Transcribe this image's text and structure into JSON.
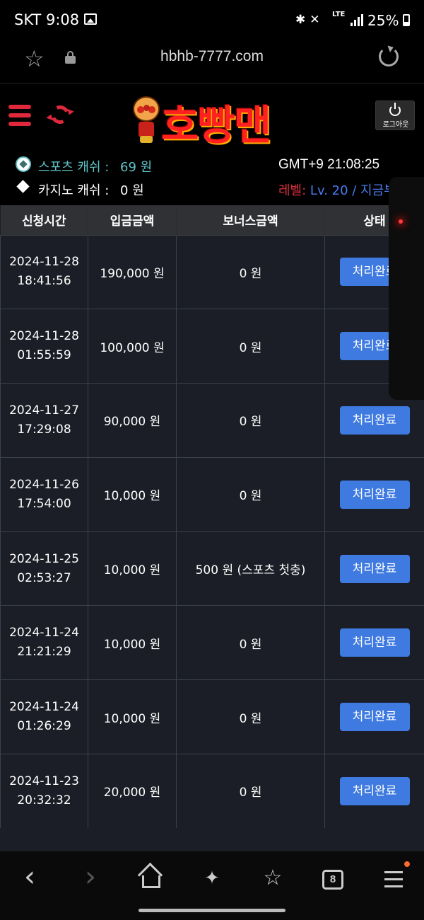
{
  "status_bar": {
    "time": "SKT 9:08",
    "battery": "25%",
    "network": "LTE"
  },
  "browser": {
    "url": "hbhb-7777.com",
    "open_tabs": "8"
  },
  "site": {
    "logo_text": "호빵맨",
    "logout_label": "로그아웃",
    "sports_cash_label": "스포츠 캐쉬 :",
    "sports_cash_value": "69 원",
    "casino_cash_label": "카지노 캐쉬 :",
    "casino_cash_value": "0 원",
    "clock": "GMT+9 21:08:25",
    "level_label": "레벨:",
    "level_value": "Lv. 20 / 지금부"
  },
  "table": {
    "headers": [
      "신청시간",
      "입금금액",
      "보너스금액",
      "상태"
    ],
    "rows": [
      {
        "date": "2024-11-28",
        "time": "18:41:56",
        "amount": "190,000 원",
        "bonus": "0 원",
        "status": "처리완료"
      },
      {
        "date": "2024-11-28",
        "time": "01:55:59",
        "amount": "100,000 원",
        "bonus": "0 원",
        "status": "처리완료"
      },
      {
        "date": "2024-11-27",
        "time": "17:29:08",
        "amount": "90,000 원",
        "bonus": "0 원",
        "status": "처리완료"
      },
      {
        "date": "2024-11-26",
        "time": "17:54:00",
        "amount": "10,000 원",
        "bonus": "0 원",
        "status": "처리완료"
      },
      {
        "date": "2024-11-25",
        "time": "02:53:27",
        "amount": "10,000 원",
        "bonus": "500 원 (스포츠 첫충)",
        "status": "처리완료"
      },
      {
        "date": "2024-11-24",
        "time": "21:21:29",
        "amount": "10,000 원",
        "bonus": "0 원",
        "status": "처리완료"
      },
      {
        "date": "2024-11-24",
        "time": "01:26:29",
        "amount": "10,000 원",
        "bonus": "0 원",
        "status": "처리완료"
      },
      {
        "date": "2024-11-23",
        "time": "20:32:32",
        "amount": "20,000 원",
        "bonus": "0 원",
        "status": "처리완료"
      }
    ]
  },
  "colors": {
    "accent_red": "#e0283c",
    "status_button": "#3e7ae0",
    "sports_cash": "#5fc3c6",
    "level_value": "#4a7cf0"
  },
  "icons": {
    "menu": "hamburger-icon",
    "refresh": "refresh-icon",
    "logout": "power-icon",
    "sports": "soccer-ball-icon",
    "casino": "diamond-icon"
  }
}
